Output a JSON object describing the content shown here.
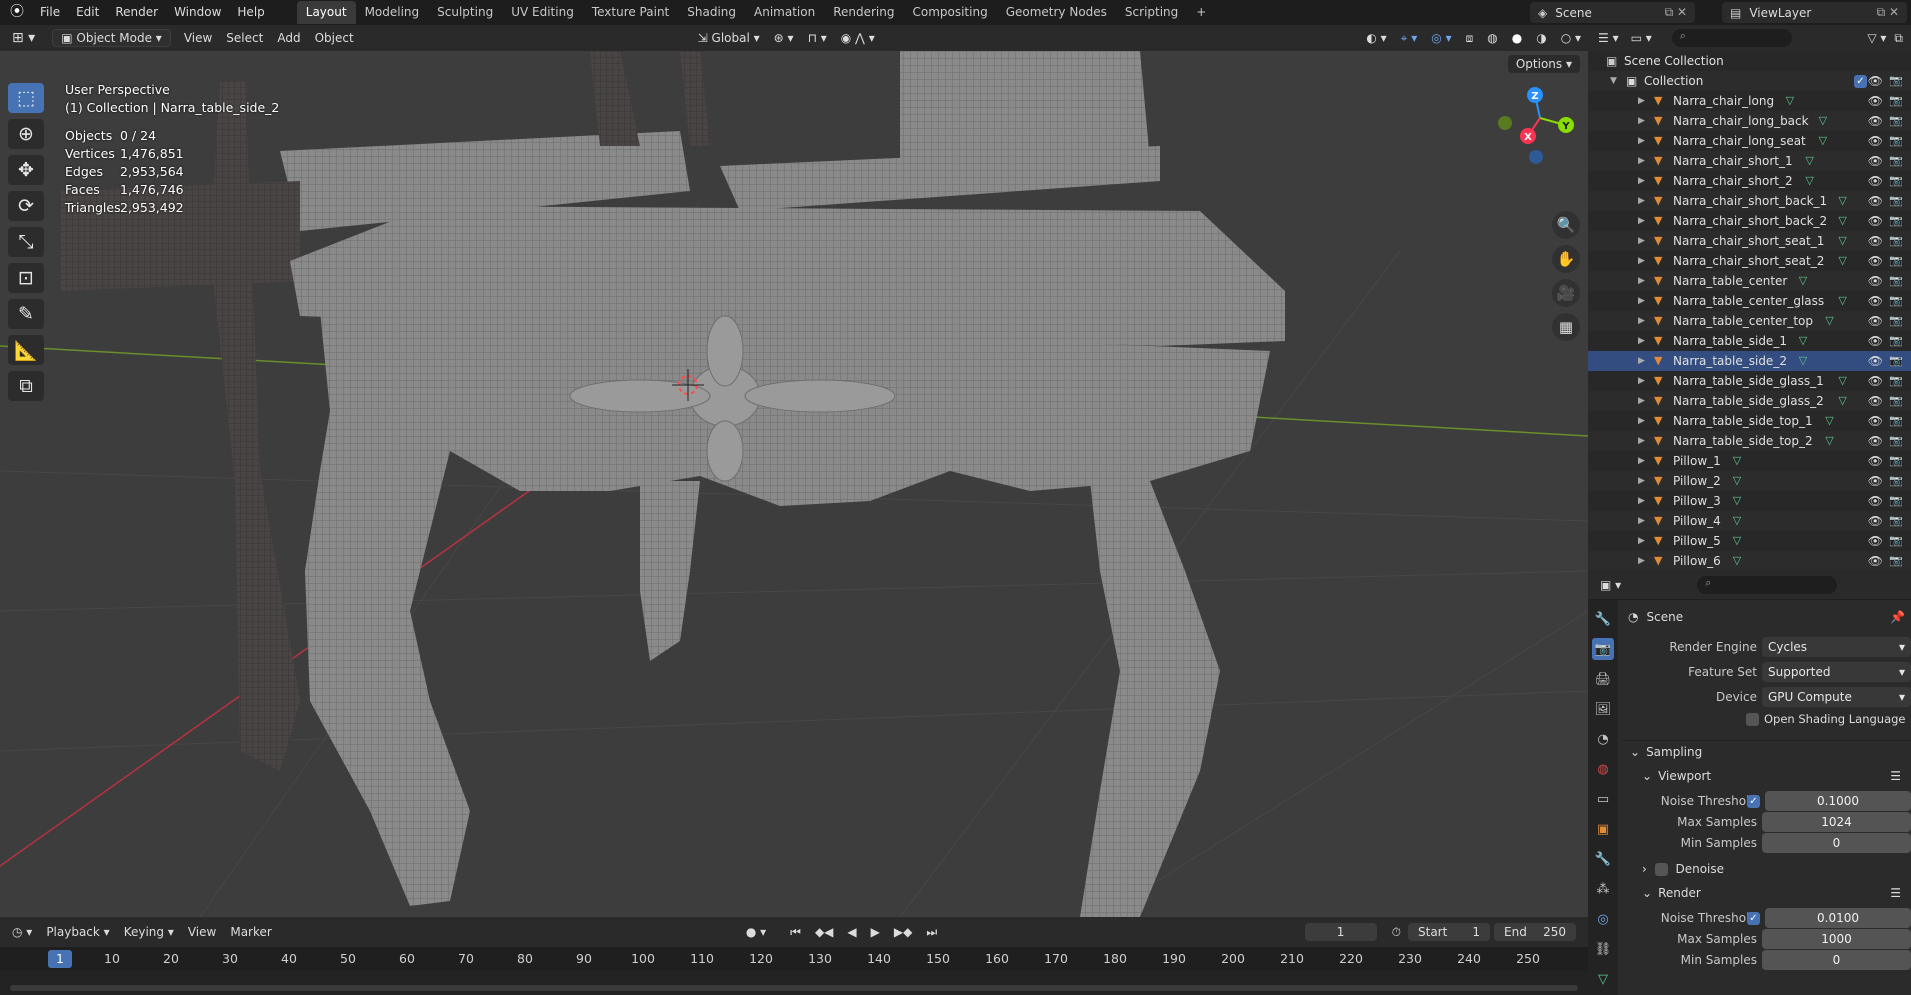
{
  "topbar": {
    "menus": [
      "File",
      "Edit",
      "Render",
      "Window",
      "Help"
    ],
    "workspaces": [
      "Layout",
      "Modeling",
      "Sculpting",
      "UV Editing",
      "Texture Paint",
      "Shading",
      "Animation",
      "Rendering",
      "Compositing",
      "Geometry Nodes",
      "Scripting"
    ],
    "active_workspace": "Layout",
    "add_tab": "+",
    "scene": "Scene",
    "view_layer": "ViewLayer"
  },
  "viewport_header": {
    "mode": "Object Mode",
    "menus": [
      "View",
      "Select",
      "Add",
      "Object"
    ],
    "transform_orientation": "Global",
    "options": "Options"
  },
  "viewport": {
    "view_name": "User Perspective",
    "context": "(1) Collection | Narra_table_side_2",
    "stats": [
      {
        "label": "Objects",
        "value": "0 / 24"
      },
      {
        "label": "Vertices",
        "value": "1,476,851"
      },
      {
        "label": "Edges",
        "value": "2,953,564"
      },
      {
        "label": "Faces",
        "value": "1,476,746"
      },
      {
        "label": "Triangles",
        "value": "2,953,492"
      }
    ],
    "gizmo": {
      "x": "X",
      "y": "Y",
      "z": "Z"
    }
  },
  "timeline": {
    "menus": [
      "Playback",
      "Keying",
      "View",
      "Marker"
    ],
    "current_frame": "1",
    "start_label": "Start",
    "start": "1",
    "end_label": "End",
    "end": "250",
    "ruler": [
      "10",
      "20",
      "30",
      "40",
      "50",
      "60",
      "70",
      "80",
      "90",
      "100",
      "110",
      "120",
      "130",
      "140",
      "150",
      "160",
      "170",
      "180",
      "190",
      "200",
      "210",
      "220",
      "230",
      "240",
      "250"
    ],
    "ruler_current": "1"
  },
  "outliner": {
    "scene_collection": "Scene Collection",
    "collection": "Collection",
    "items": [
      "Narra_chair_long",
      "Narra_chair_long_back",
      "Narra_chair_long_seat",
      "Narra_chair_short_1",
      "Narra_chair_short_2",
      "Narra_chair_short_back_1",
      "Narra_chair_short_back_2",
      "Narra_chair_short_seat_1",
      "Narra_chair_short_seat_2",
      "Narra_table_center",
      "Narra_table_center_glass",
      "Narra_table_center_top",
      "Narra_table_side_1",
      "Narra_table_side_2",
      "Narra_table_side_glass_1",
      "Narra_table_side_glass_2",
      "Narra_table_side_top_1",
      "Narra_table_side_top_2",
      "Pillow_1",
      "Pillow_2",
      "Pillow_3",
      "Pillow_4",
      "Pillow_5",
      "Pillow_6"
    ]
  },
  "properties": {
    "context": "Scene",
    "render_engine_label": "Render Engine",
    "render_engine": "Cycles",
    "feature_set_label": "Feature Set",
    "feature_set": "Supported",
    "device_label": "Device",
    "device": "GPU Compute",
    "osl_label": "Open Shading Language",
    "sampling": "Sampling",
    "viewport": "Viewport",
    "vp_noise_label": "Noise Threshold",
    "vp_noise": "0.1000",
    "vp_max_label": "Max Samples",
    "vp_max": "1024",
    "vp_min_label": "Min Samples",
    "vp_min": "0",
    "denoise": "Denoise",
    "render": "Render",
    "r_noise_label": "Noise Threshold",
    "r_noise": "0.0100",
    "r_max_label": "Max Samples",
    "r_max": "1000",
    "r_min_label": "Min Samples",
    "r_min": "0"
  },
  "colors": {
    "accent": "#4772b3",
    "x_axis": "#ff3352",
    "y_axis": "#8bdc00",
    "z_axis": "#2890ff",
    "object_icon": "#e28a36",
    "mesh_icon": "#5ec98e"
  }
}
